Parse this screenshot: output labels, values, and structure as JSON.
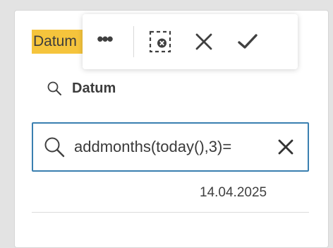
{
  "field": {
    "title": "Datum"
  },
  "toolbar": {
    "more_icon": "more-horizontal-icon",
    "more_glyph": "•••",
    "clear_selections_icon": "clear-selections-icon",
    "cancel_icon": "close-icon",
    "confirm_icon": "checkmark-icon"
  },
  "search": {
    "label": "Datum",
    "value": "=addmonths(today(),3)",
    "clear_icon": "close-icon"
  },
  "results": [
    {
      "value": "14.04.2025"
    }
  ],
  "colors": {
    "highlight": "#f5c43c",
    "focus_border": "#3a7fb0",
    "icon": "#404040"
  }
}
